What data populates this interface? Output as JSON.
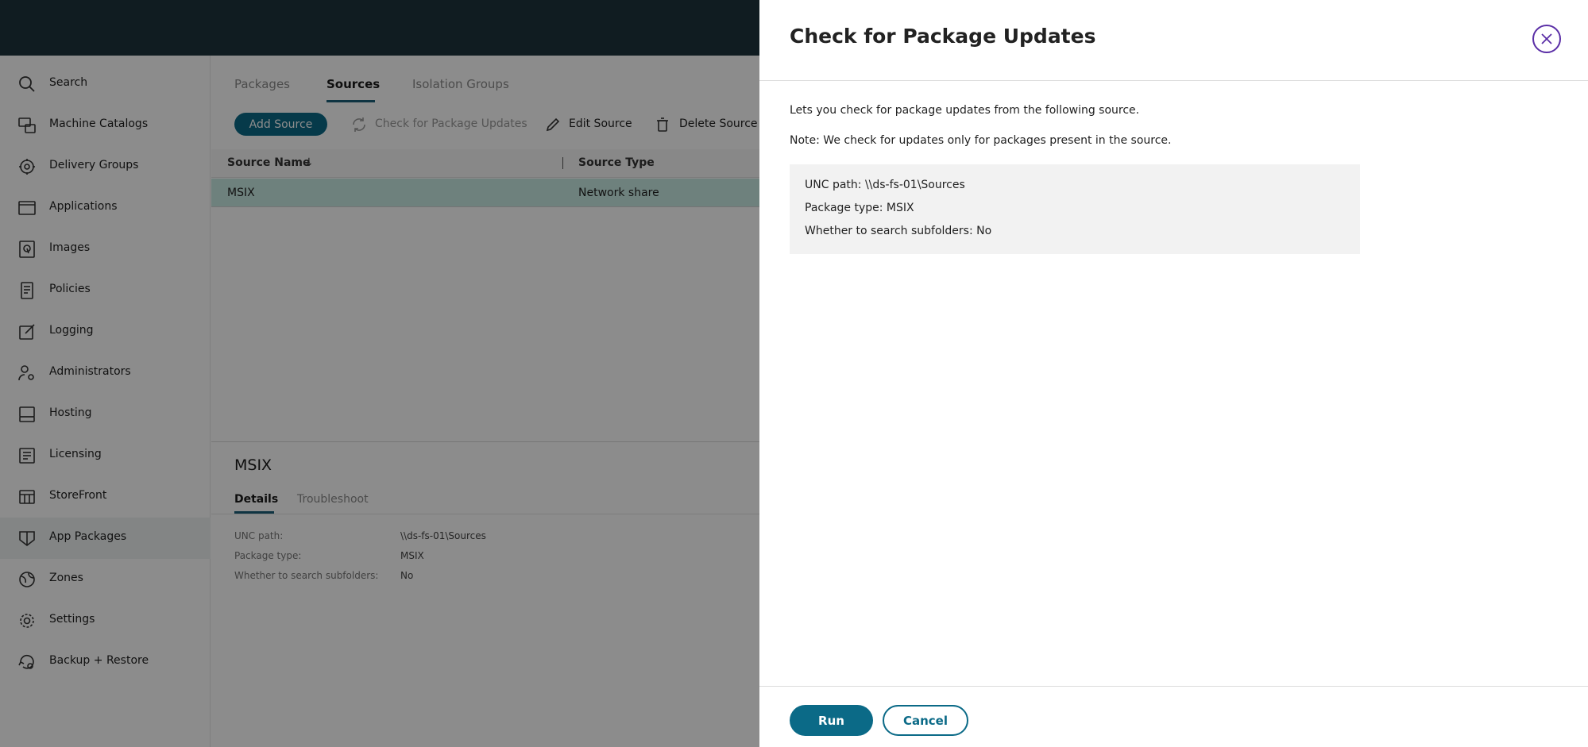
{
  "sidebar": {
    "items": [
      {
        "label": "Search",
        "icon": "search-icon"
      },
      {
        "label": "Machine Catalogs",
        "icon": "machine-catalogs-icon"
      },
      {
        "label": "Delivery Groups",
        "icon": "delivery-groups-icon"
      },
      {
        "label": "Applications",
        "icon": "applications-icon"
      },
      {
        "label": "Images",
        "icon": "images-icon"
      },
      {
        "label": "Policies",
        "icon": "policies-icon"
      },
      {
        "label": "Logging",
        "icon": "logging-icon"
      },
      {
        "label": "Administrators",
        "icon": "administrators-icon"
      },
      {
        "label": "Hosting",
        "icon": "hosting-icon"
      },
      {
        "label": "Licensing",
        "icon": "licensing-icon"
      },
      {
        "label": "StoreFront",
        "icon": "storefront-icon"
      },
      {
        "label": "App Packages",
        "icon": "app-packages-icon",
        "active": true
      },
      {
        "label": "Zones",
        "icon": "zones-icon"
      },
      {
        "label": "Settings",
        "icon": "settings-icon"
      },
      {
        "label": "Backup + Restore",
        "icon": "backup-restore-icon"
      }
    ]
  },
  "main": {
    "tabs": [
      {
        "label": "Packages"
      },
      {
        "label": "Sources",
        "active": true
      },
      {
        "label": "Isolation Groups"
      }
    ],
    "toolbar": {
      "add_source": "Add Source",
      "check_updates": "Check for Package Updates",
      "edit_source": "Edit Source",
      "delete_source": "Delete Source"
    },
    "grid": {
      "columns": [
        "Source Name",
        "Source Type"
      ],
      "rows": [
        {
          "name": "MSIX",
          "type": "Network share"
        }
      ]
    },
    "details": {
      "title": "MSIX",
      "tabs": [
        "Details",
        "Troubleshoot"
      ],
      "fields": [
        {
          "key": "UNC path:",
          "value": "\\\\ds-fs-01\\Sources"
        },
        {
          "key": "Package type:",
          "value": "MSIX"
        },
        {
          "key": "Whether to search subfolders:",
          "value": "No"
        }
      ]
    }
  },
  "panel": {
    "title": "Check for Package Updates",
    "description": "Lets you check for package updates from the following source.",
    "note": "Note: We check for updates only for packages present in the source.",
    "info": {
      "unc_path": "UNC path: \\\\ds-fs-01\\Sources",
      "package_type": "Package type: MSIX",
      "subfolders": "Whether to search subfolders: No"
    },
    "run_label": "Run",
    "cancel_label": "Cancel"
  },
  "colors": {
    "accent": "#0b6a87",
    "close_ring": "#5a2ea6",
    "topbar": "#1e343c"
  }
}
